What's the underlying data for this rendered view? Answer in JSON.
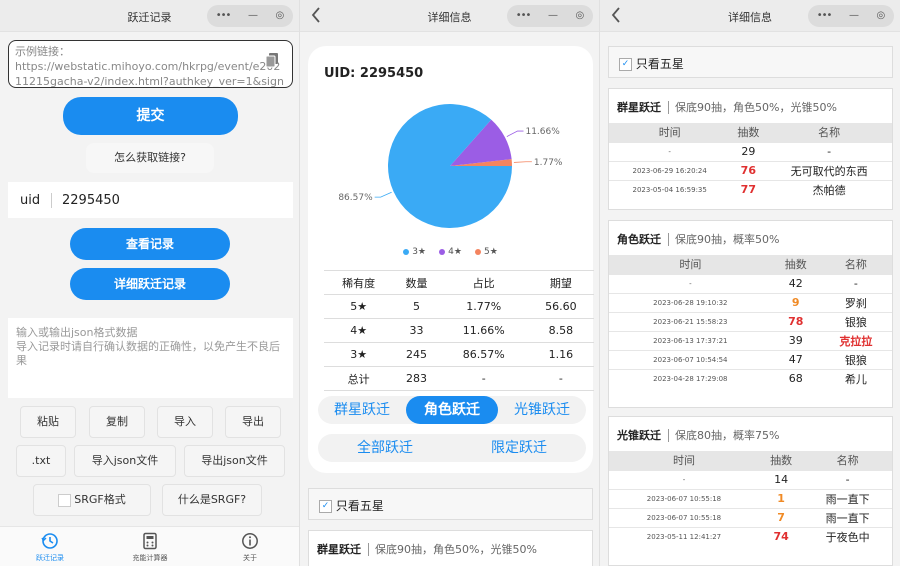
{
  "panel1": {
    "title": "跃迁记录",
    "link_placeholder": "示例链接：\nhttps://webstatic.mihoyo.com/hkrpg/event/e20211215gacha-v2/index.html?authkey_ver=1&sign",
    "submit": "提交",
    "how_to": "怎么获取链接?",
    "uid_label": "uid",
    "uid_value": "2295450",
    "view_records": "查看记录",
    "detailed_records": "详细跃迁记录",
    "json_placeholder": "输入或输出json格式数据\n导入记录时请自行确认数据的正确性，以免产生不良后果",
    "btn_paste": "粘贴",
    "btn_copy": "复制",
    "btn_import": "导入",
    "btn_export": "导出",
    "btn_txt": ".txt",
    "btn_import_json": "导入json文件",
    "btn_export_json": "导出json文件",
    "srgf_format": "SRGF格式",
    "what_srgf": "什么是SRGF?",
    "nav": [
      "跃迁记录",
      "充能计算器",
      "关于"
    ]
  },
  "panel2": {
    "title": "详细信息",
    "uid_line": "UID: 2295450",
    "legend": [
      "3★",
      "4★",
      "5★"
    ],
    "table_headers": [
      "稀有度",
      "数量",
      "占比",
      "期望"
    ],
    "table_rows": [
      [
        "5★",
        "5",
        "1.77%",
        "56.60"
      ],
      [
        "4★",
        "33",
        "11.66%",
        "8.58"
      ],
      [
        "3★",
        "245",
        "86.57%",
        "1.16"
      ],
      [
        "总计",
        "283",
        "-",
        "-"
      ]
    ],
    "tabs_row1": [
      "群星跃迁",
      "角色跃迁",
      "光锥跃迁"
    ],
    "tabs_row2": [
      "全部跃迁",
      "限定跃迁"
    ],
    "five_star_only": "只看五星",
    "section_title": "群星跃迁",
    "section_desc": "保底90抽，角色50%，光锥50%"
  },
  "panel3": {
    "title": "详细信息",
    "five_star_only": "只看五星",
    "col_headers": [
      "时间",
      "抽数",
      "名称"
    ],
    "sections": [
      {
        "title": "群星跃迁",
        "desc": "保底90抽，角色50%，光锥50%",
        "rows": [
          [
            "-",
            "29",
            "-"
          ],
          [
            "2023-06-29 16:20:24",
            "76",
            "无可取代的东西"
          ],
          [
            "2023-05-04 16:59:35",
            "77",
            "杰帕德"
          ]
        ]
      },
      {
        "title": "角色跃迁",
        "desc": "保底90抽，概率50%",
        "rows": [
          [
            "-",
            "42",
            "-"
          ],
          [
            "2023-06-28 19:10:32",
            "9",
            "罗刹"
          ],
          [
            "2023-06-21 15:58:23",
            "78",
            "银狼"
          ],
          [
            "2023-06-13 17:37:21",
            "39",
            "克拉拉"
          ],
          [
            "2023-06-07 10:54:54",
            "47",
            "银狼"
          ],
          [
            "2023-04-28 17:29:08",
            "68",
            "希儿"
          ]
        ]
      },
      {
        "title": "光锥跃迁",
        "desc": "保底80抽，概率75%",
        "rows": [
          [
            "-",
            "14",
            "-"
          ],
          [
            "2023-06-07 10:55:18",
            "1",
            "雨一直下"
          ],
          [
            "2023-06-07 10:55:18",
            "7",
            "雨一直下"
          ],
          [
            "2023-05-11 12:41:27",
            "74",
            "于夜色中"
          ]
        ]
      }
    ]
  },
  "chart_data": {
    "type": "pie",
    "labels": [
      "3★",
      "4★",
      "5★"
    ],
    "values": [
      86.57,
      11.66,
      1.77
    ],
    "data_labels": [
      "86.57%",
      "11.66%",
      "1.77%"
    ],
    "colors": [
      "#3aaaf5",
      "#9b5de5",
      "#f4845f"
    ],
    "legend_position": "bottom"
  }
}
